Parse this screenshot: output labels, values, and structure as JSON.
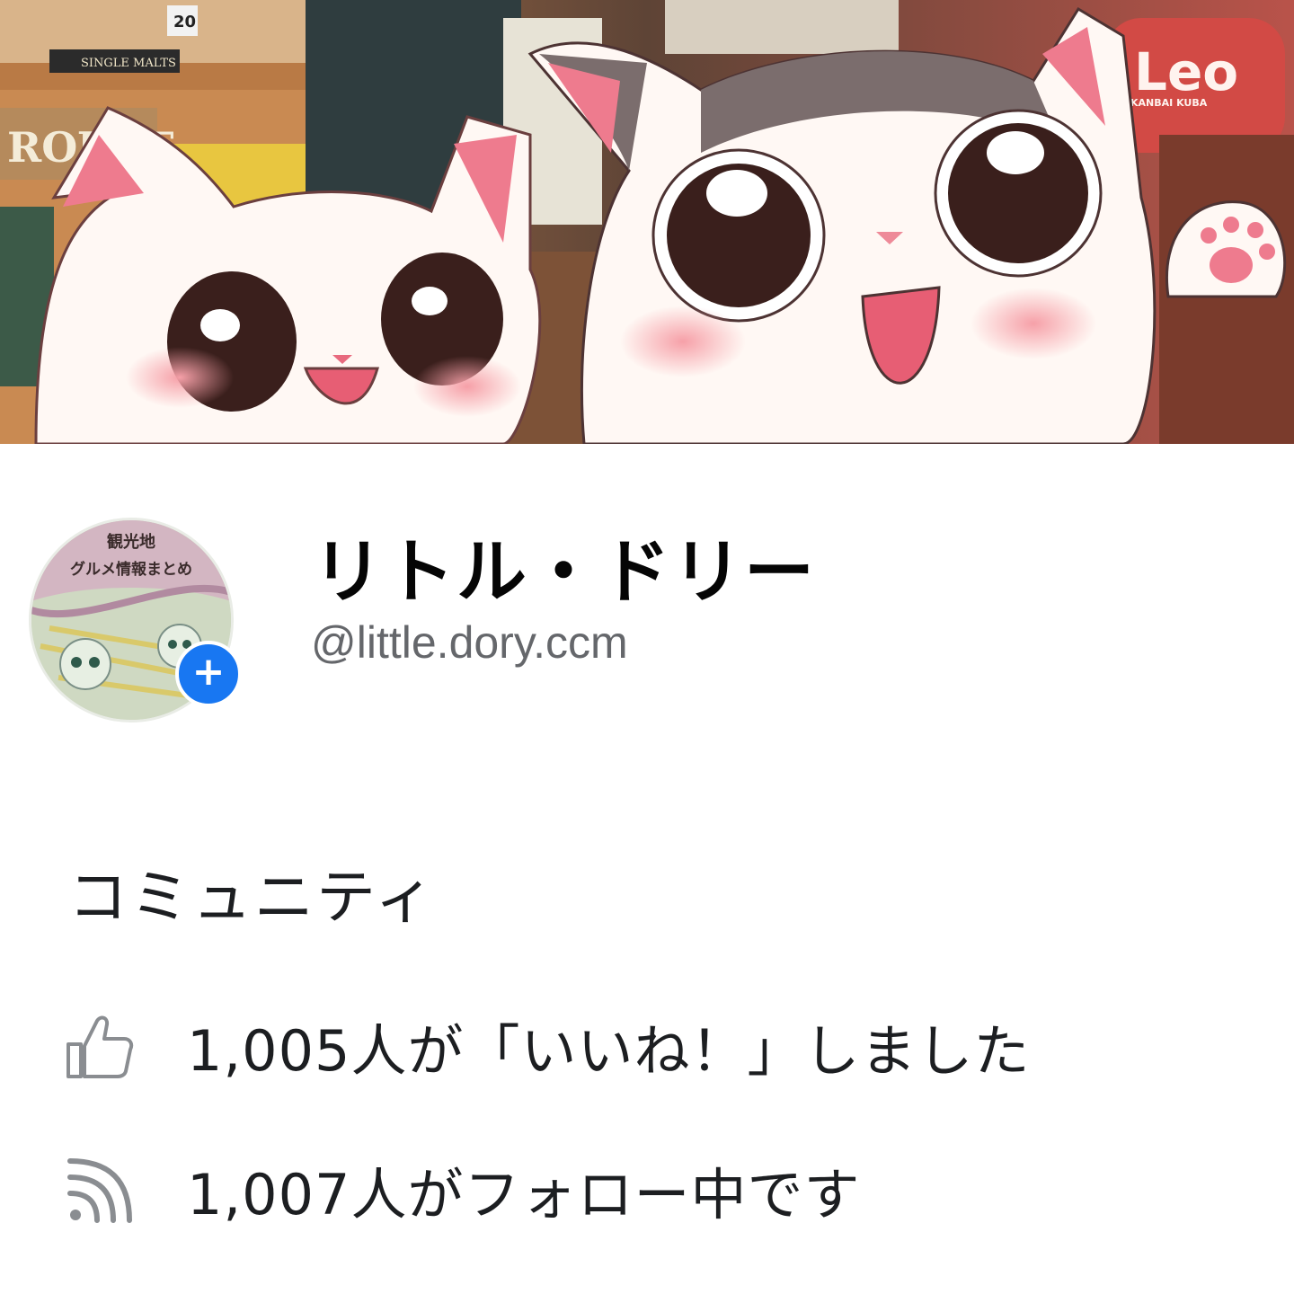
{
  "profile": {
    "name": "リトル・ドリー",
    "handle": "@little.dory.ccm",
    "avatar_caption_line1": "観光地",
    "avatar_caption_line2": "グルメ情報まとめ",
    "add_button_icon": "plus-icon"
  },
  "cover": {
    "sign_text": "ROUTE",
    "box_label": "SINGLE MALTS",
    "badge_number": "20",
    "logo_text": "Leo",
    "logo_subtext": "KANBAI KUBA"
  },
  "community": {
    "title": "コミュニティ",
    "likes_text": "1,005人が「いいね！」しました",
    "likes_icon": "thumbs-up-icon",
    "follow_text": "1,007人がフォロー中です",
    "follow_icon": "rss-feed-icon"
  },
  "colors": {
    "accent": "#1877f2",
    "secondary_text": "#65676b"
  }
}
